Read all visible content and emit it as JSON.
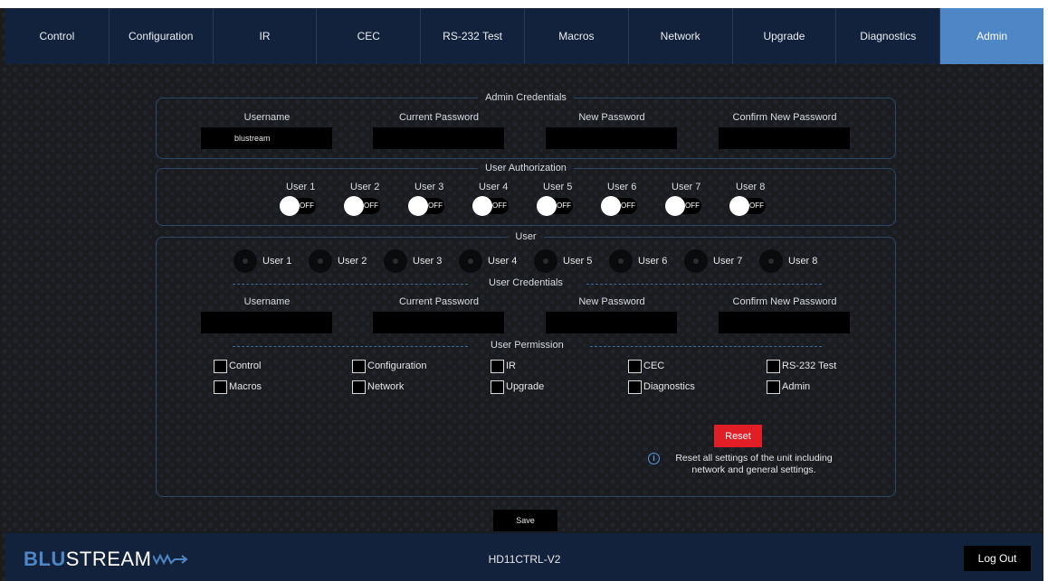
{
  "nav": {
    "tabs": [
      {
        "label": "Control"
      },
      {
        "label": "Configuration"
      },
      {
        "label": "IR"
      },
      {
        "label": "CEC"
      },
      {
        "label": "RS-232 Test"
      },
      {
        "label": "Macros"
      },
      {
        "label": "Network"
      },
      {
        "label": "Upgrade"
      },
      {
        "label": "Diagnostics"
      },
      {
        "label": "Admin"
      }
    ],
    "active": "Admin"
  },
  "admin_credentials": {
    "legend": "Admin Credentials",
    "username_label": "Username",
    "username_value": "blustream",
    "current_password_label": "Current Password",
    "new_password_label": "New Password",
    "confirm_password_label": "Confirm New Password"
  },
  "user_authorization": {
    "legend": "User Authorization",
    "users": [
      {
        "label": "User 1",
        "state": "OFF"
      },
      {
        "label": "User 2",
        "state": "OFF"
      },
      {
        "label": "User 3",
        "state": "OFF"
      },
      {
        "label": "User 4",
        "state": "OFF"
      },
      {
        "label": "User 5",
        "state": "OFF"
      },
      {
        "label": "User 6",
        "state": "OFF"
      },
      {
        "label": "User 7",
        "state": "OFF"
      },
      {
        "label": "User 8",
        "state": "OFF"
      }
    ]
  },
  "user": {
    "legend": "User",
    "radios": [
      "User 1",
      "User 2",
      "User 3",
      "User 4",
      "User 5",
      "User 6",
      "User 7",
      "User 8"
    ],
    "credentials_title": "User Credentials",
    "username_label": "Username",
    "current_password_label": "Current Password",
    "new_password_label": "New Password",
    "confirm_password_label": "Confirm New Password",
    "permission_title": "User Permission",
    "permissions": [
      "Control",
      "Configuration",
      "IR",
      "CEC",
      "RS-232 Test",
      "Macros",
      "Network",
      "Upgrade",
      "Diagnostics",
      "Admin"
    ]
  },
  "reset": {
    "button_label": "Reset",
    "info_icon": "i",
    "info_text": "Reset all settings of the unit including network and general settings."
  },
  "save_label": "Save",
  "footer": {
    "logo_part1": "BLU",
    "logo_part2": "STREAM",
    "device_name": "HD11CTRL-V2",
    "logout_label": "Log Out"
  },
  "colors": {
    "nav_bg": "#13223c",
    "active_tab": "#4f86c6",
    "reset_red": "#e11d26",
    "border": "#2c4664"
  }
}
